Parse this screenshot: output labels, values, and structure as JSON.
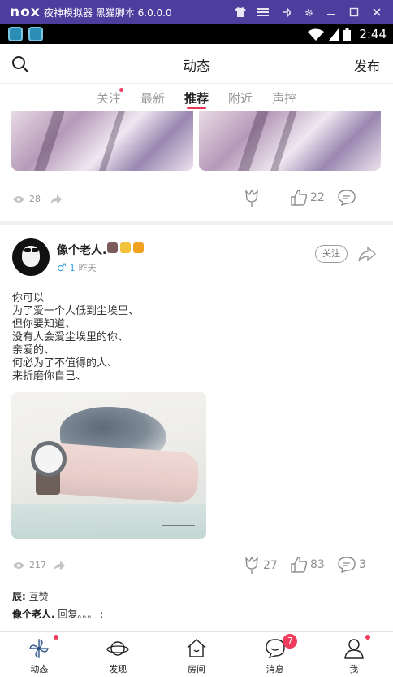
{
  "emulator": {
    "logo": "nox",
    "title": "夜神模拟器 黑猫脚本 6.0.0.0",
    "controls": [
      "shirt-icon",
      "menu-icon",
      "pin-icon",
      "gear-icon",
      "minimize-icon",
      "maximize-icon",
      "close-icon"
    ]
  },
  "status_bar": {
    "time": "2:44",
    "icons": [
      "wifi-icon",
      "signal-icon",
      "battery-icon"
    ]
  },
  "header": {
    "title": "动态",
    "publish_label": "发布"
  },
  "tabs": [
    {
      "label": "关注",
      "active": false,
      "dot": true
    },
    {
      "label": "最新",
      "active": false,
      "dot": false
    },
    {
      "label": "推荐",
      "active": true,
      "dot": false
    },
    {
      "label": "附近",
      "active": false,
      "dot": false
    },
    {
      "label": "声控",
      "active": false,
      "dot": false
    }
  ],
  "posts": [
    {
      "views": "28",
      "likes": "22"
    },
    {
      "username": "像个老人.",
      "level": "1",
      "time": "昨天",
      "follow_label": "关注",
      "text_lines": [
        "你可以",
        "为了爱一个人低到尘埃里、",
        "但你要知道、",
        "没有人会爱尘埃里的你、",
        "亲爱的、",
        "何必为了不值得的人、",
        "来折磨你自己、"
      ],
      "views": "217",
      "flowers": "27",
      "likes": "83",
      "comments": "3",
      "comment_list": [
        {
          "user": "辰:",
          "text": "互赞"
        },
        {
          "user": "像个老人.",
          "text": "回复。。。 :"
        }
      ]
    }
  ],
  "bottom_nav": [
    {
      "label": "动态",
      "icon": "pinwheel-icon",
      "dot": true,
      "badge": ""
    },
    {
      "label": "发现",
      "icon": "planet-icon",
      "dot": false,
      "badge": ""
    },
    {
      "label": "房间",
      "icon": "house-icon",
      "dot": false,
      "badge": ""
    },
    {
      "label": "消息",
      "icon": "chat-smile-icon",
      "dot": false,
      "badge": "7"
    },
    {
      "label": "我",
      "icon": "person-icon",
      "dot": true,
      "badge": ""
    }
  ],
  "colors": {
    "emulator_bar": "#4d3e9e",
    "accent": "#e8375a",
    "gender_male": "#3aa0e8"
  }
}
